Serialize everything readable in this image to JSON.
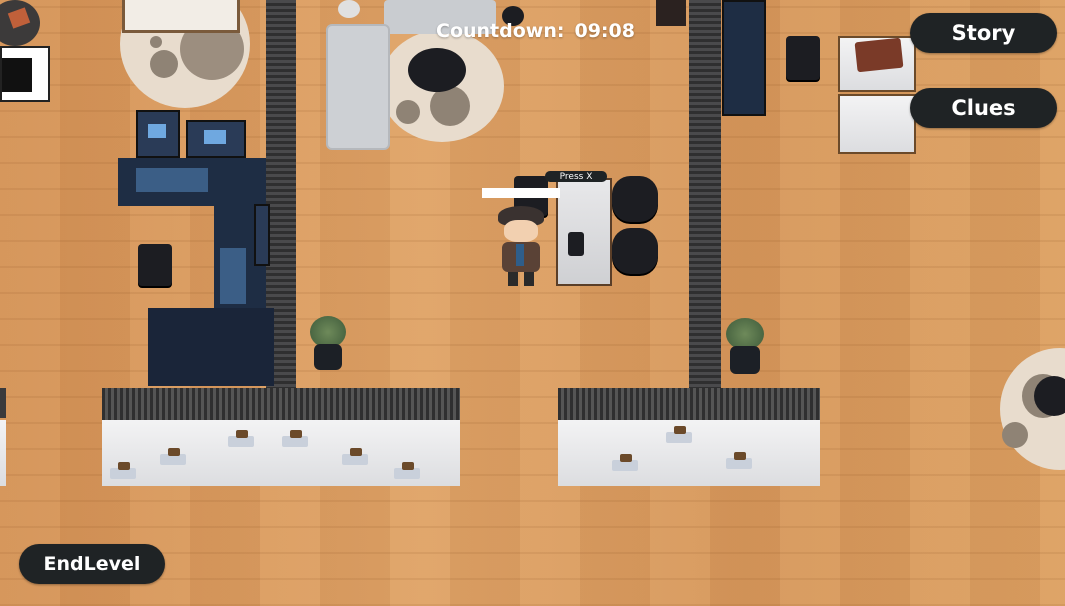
{
  "hud": {
    "countdown_label": "Countdown:",
    "countdown_time": "09:08",
    "story_button": "Story",
    "clues_button": "Clues",
    "endlevel_button": "EndLevel"
  },
  "prompt": {
    "interact_hint": "Press X"
  },
  "colors": {
    "hud_button_bg": "#1f2325",
    "hud_text": "#ffffff",
    "floor": "#d9985d",
    "wall": "#3a3a3c"
  }
}
